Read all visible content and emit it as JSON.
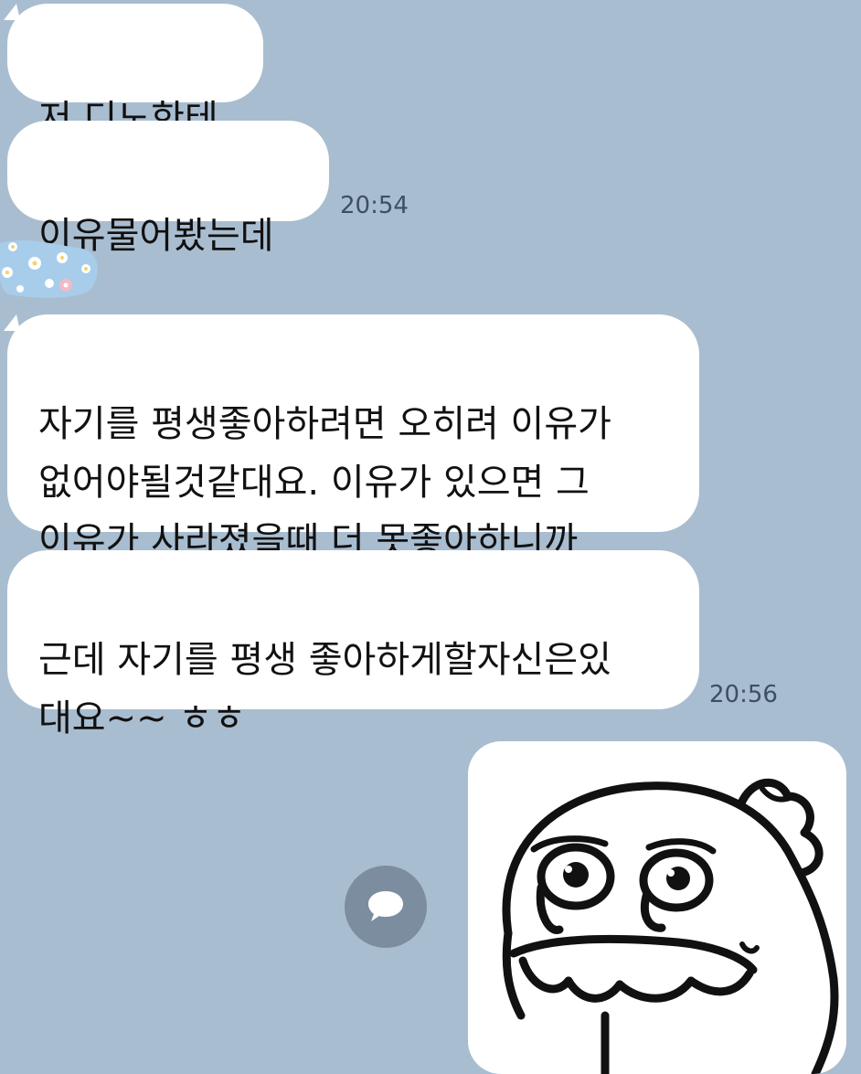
{
  "chat": {
    "messages": [
      {
        "text": "저 디노한테"
      },
      {
        "text": "이유물어봤는데",
        "time": "20:54"
      },
      {
        "text": "자기를 평생좋아하려면 오히려 이유가\n없어야될것같대요. 이유가 있으면 그\n이유가 사라졌을때 더 못좋아하니까"
      },
      {
        "text": "근데 자기를 평생 좋아하게할자신은있\n대요~~ ㅎㅎ",
        "time": "20:56"
      }
    ],
    "sticker": {
      "icon": "flower-pattern-bubble-icon"
    },
    "emoticon": {
      "icon": "crying-character-emoticon"
    },
    "share_button": {
      "icon": "speech-bubble-icon"
    }
  },
  "colors": {
    "background": "#a9bdd0",
    "bubble": "#ffffff",
    "timestamp": "#3c4f63",
    "share_button": "#7b8d9f"
  }
}
